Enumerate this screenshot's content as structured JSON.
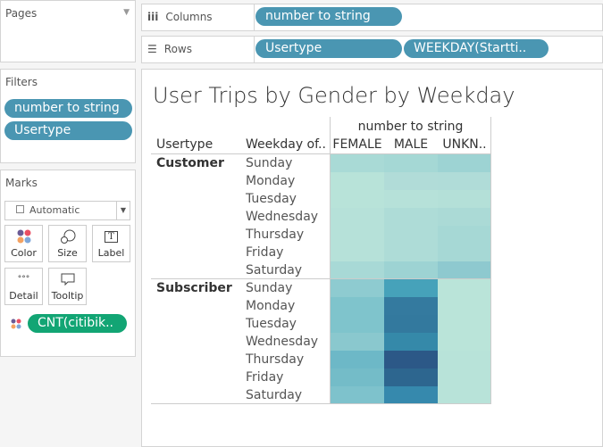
{
  "pages": {
    "title": "Pages"
  },
  "filters": {
    "title": "Filters",
    "items": [
      "number to string",
      "Usertype"
    ]
  },
  "marks": {
    "title": "Marks",
    "mark_type": "Automatic",
    "cards": [
      "Color",
      "Size",
      "Label",
      "Detail",
      "Tooltip"
    ],
    "color_pill": "CNT(citibik.."
  },
  "shelves": {
    "columns_label": "Columns",
    "columns": [
      "number to string"
    ],
    "rows_label": "Rows",
    "rows": [
      "Usertype",
      "WEEKDAY(Startti.."
    ]
  },
  "view": {
    "title": "User Trips by Gender by Weekday",
    "col_group_header": "number to string",
    "row_headers": [
      "Usertype",
      "Weekday of.."
    ],
    "columns": [
      "FEMALE",
      "MALE",
      "UNKN.."
    ],
    "groups": [
      {
        "name": "Customer",
        "days": [
          "Sunday",
          "Monday",
          "Tuesday",
          "Wednesday",
          "Thursday",
          "Friday",
          "Saturday"
        ],
        "colors": [
          [
            "#a9dad6",
            "#a5d8d5",
            "#9dd3d3"
          ],
          [
            "#b8e3d9",
            "#b1dcd8",
            "#b0dcd8"
          ],
          [
            "#b8e3d9",
            "#b6e1d9",
            "#b4e0d8"
          ],
          [
            "#b6e1d9",
            "#aedcd7",
            "#abdad6"
          ],
          [
            "#b6e1d9",
            "#aedcd7",
            "#a6d8d5"
          ],
          [
            "#b6e1d9",
            "#aedcd7",
            "#a6d8d5"
          ],
          [
            "#a8d9d6",
            "#9dd3d3",
            "#8ec9cf"
          ]
        ]
      },
      {
        "name": "Subscriber",
        "days": [
          "Sunday",
          "Monday",
          "Tuesday",
          "Wednesday",
          "Thursday",
          "Friday",
          "Saturday"
        ],
        "colors": [
          [
            "#8ecbd0",
            "#46a2ba",
            "#bae4d9"
          ],
          [
            "#7fc4cc",
            "#347a9f",
            "#bae4d9"
          ],
          [
            "#7fc4cc",
            "#33799e",
            "#bae4d9"
          ],
          [
            "#8ac8ce",
            "#3589a9",
            "#bae4d9"
          ],
          [
            "#6db8c7",
            "#2c5887",
            "#b8e3d9"
          ],
          [
            "#74bcc8",
            "#2d668f",
            "#b8e3d9"
          ],
          [
            "#7ec2cc",
            "#3689ad",
            "#b8e3d9"
          ]
        ]
      }
    ]
  }
}
